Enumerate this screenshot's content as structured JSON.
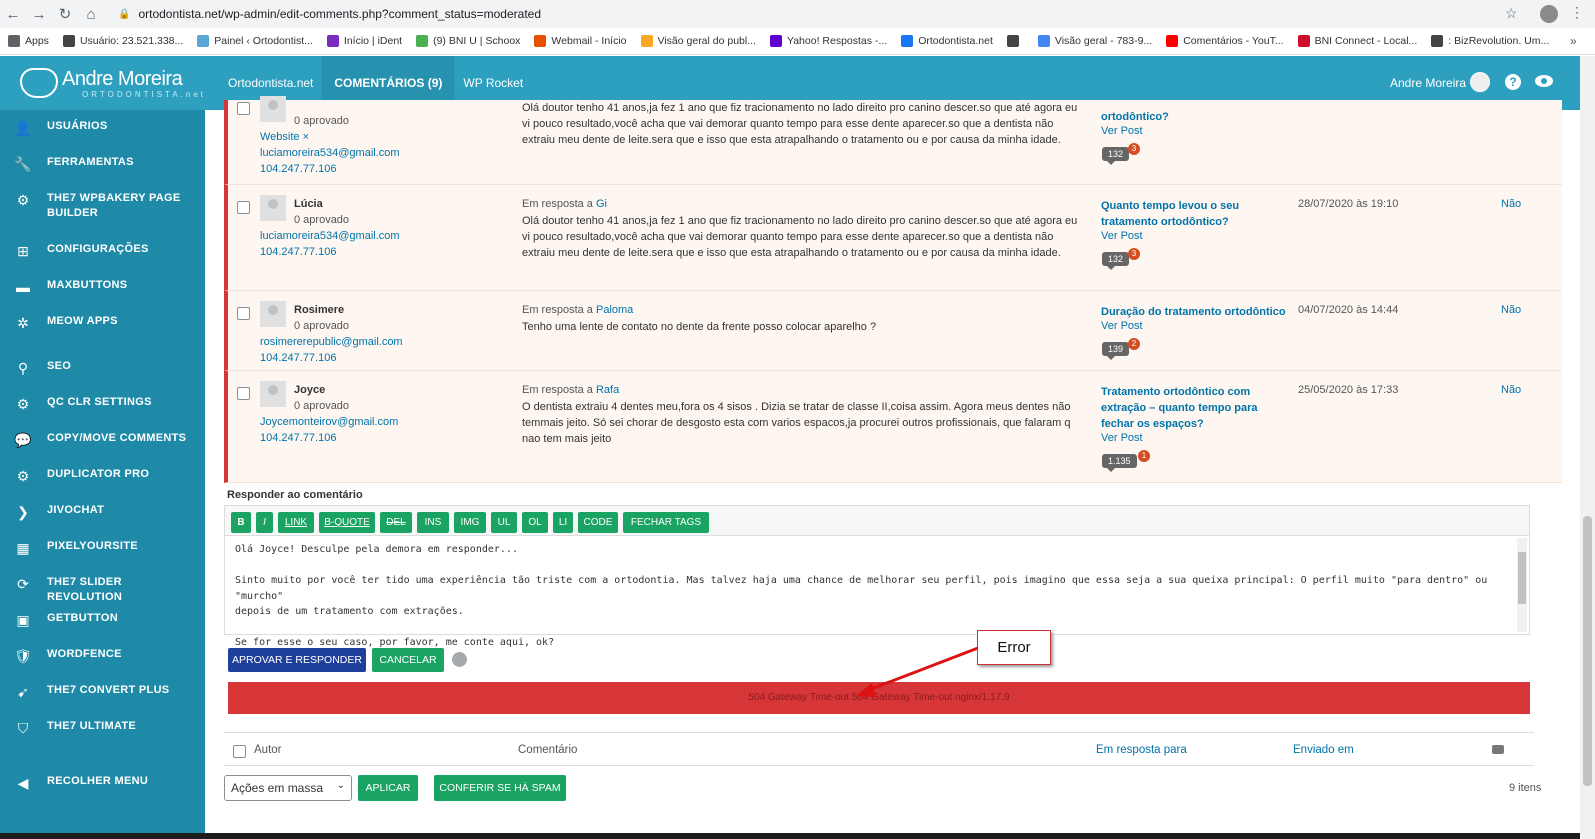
{
  "browser": {
    "url": "ortodontista.net/wp-admin/edit-comments.php?comment_status=moderated",
    "bookmarks": [
      {
        "label": "Apps",
        "color": "#5f6368"
      },
      {
        "label": "Usuário: 23.521.338...",
        "color": "#444"
      },
      {
        "label": "Painel ‹ Ortodontist...",
        "color": "#5aa7d6"
      },
      {
        "label": "Início | iDent",
        "color": "#7b2cbf"
      },
      {
        "label": "(9) BNI U | Schoox",
        "color": "#4caf50"
      },
      {
        "label": "Webmail - Início",
        "color": "#e65100"
      },
      {
        "label": "Visão geral do publ...",
        "color": "#f9a825"
      },
      {
        "label": "Yahoo! Respostas -...",
        "color": "#6001d2"
      },
      {
        "label": "Ortodontista.net",
        "color": "#1877f2"
      },
      {
        "label": "",
        "color": "#444"
      },
      {
        "label": "Visão geral - 783-9...",
        "color": "#4285f4"
      },
      {
        "label": "Comentários - YouT...",
        "color": "#ff0000"
      },
      {
        "label": "BNI Connect - Local...",
        "color": "#cf102d"
      },
      {
        "label": ": BizRevolution. Um...",
        "color": "#444"
      }
    ]
  },
  "admin_bar": {
    "logo_main": "Andre Moreira",
    "logo_sub": "ORTODONTISTA.net",
    "menu": [
      "Ortodontista.net",
      "COMENTÁRIOS (9)",
      "WP Rocket"
    ],
    "user": "Andre Moreira",
    "help": "?"
  },
  "sidebar": [
    {
      "label": "USUÁRIOS",
      "icon": "👤"
    },
    {
      "label": "FERRAMENTAS",
      "icon": "🔧"
    },
    {
      "label": "THE7 WPBAKERY PAGE BUILDER",
      "icon": "⚙"
    },
    {
      "label": "CONFIGURAÇÕES",
      "icon": "⊞"
    },
    {
      "label": "MAXBUTTONS",
      "icon": "▬"
    },
    {
      "label": "MEOW APPS",
      "icon": "✲"
    },
    {
      "label": "SEO",
      "icon": "⚲"
    },
    {
      "label": "QC CLR SETTINGS",
      "icon": "⚙"
    },
    {
      "label": "COPY/MOVE COMMENTS",
      "icon": "💬"
    },
    {
      "label": "DUPLICATOR PRO",
      "icon": "⚙"
    },
    {
      "label": "JIVOCHAT",
      "icon": "❯"
    },
    {
      "label": "PIXELYOURSITE",
      "icon": "▦"
    },
    {
      "label": "THE7 SLIDER REVOLUTION",
      "icon": "⟳"
    },
    {
      "label": "GETBUTTON",
      "icon": "▣"
    },
    {
      "label": "WORDFENCE",
      "icon": "🛡"
    },
    {
      "label": "THE7 CONVERT PLUS",
      "icon": "➹"
    },
    {
      "label": "THE7 ULTIMATE",
      "icon": "⛉"
    },
    {
      "label": "RECOLHER MENU",
      "icon": "◀"
    }
  ],
  "comments": [
    {
      "author": "",
      "status": "0 aprovado",
      "website": "Website ×",
      "email": "luciamoreira534@gmail.com",
      "ip": "104.247.77.106",
      "in_reply_prefix": "",
      "in_reply_name": "",
      "text": "Olá doutor tenho 41 anos,ja fez 1 ano que fiz tracionamento no lado direito pro canino descer.so que até agora eu vi pouco resultado,você acha que vai demorar quanto tempo para esse dente aparecer.so que a dentista não extraiu meu dente de leite.sera que e isso que esta atrapalhando o tratamento ou e por causa da minha idade.",
      "post": "ortodôntico?",
      "ver_post": "Ver Post",
      "count": "132",
      "pending": "3",
      "date": "",
      "nao": ""
    },
    {
      "author": "Lúcia",
      "status": "0 aprovado",
      "website": "",
      "email": "luciamoreira534@gmail.com",
      "ip": "104.247.77.106",
      "in_reply_prefix": "Em resposta a ",
      "in_reply_name": "Gi",
      "text": "Olá doutor tenho 41 anos,ja fez 1 ano que fiz tracionamento no lado direito pro canino descer.so que até agora eu vi pouco resultado,você acha que vai demorar quanto tempo para esse dente aparecer.so que a dentista não extraiu meu dente de leite.sera que e isso que esta atrapalhando o tratamento ou e por causa da minha idade.",
      "post": "Quanto tempo levou o seu tratamento ortodôntico?",
      "ver_post": "Ver Post",
      "count": "132",
      "pending": "3",
      "date": "28/07/2020 às 19:10",
      "nao": "Não"
    },
    {
      "author": "Rosimere",
      "status": "0 aprovado",
      "website": "",
      "email": "rosimererepublic@gmail.com",
      "ip": "104.247.77.106",
      "in_reply_prefix": "Em resposta a ",
      "in_reply_name": "Paloma",
      "text": "Tenho uma lente de contato no dente da frente posso colocar aparelho ?",
      "post": "Duração do tratamento ortodôntico",
      "ver_post": "Ver Post",
      "count": "139",
      "pending": "2",
      "date": "04/07/2020 às 14:44",
      "nao": "Não"
    },
    {
      "author": "Joyce",
      "status": "0 aprovado",
      "website": "",
      "email": "Joycemonteirov@gmail.com",
      "ip": "104.247.77.106",
      "in_reply_prefix": "Em resposta a ",
      "in_reply_name": "Rafa",
      "text": "O dentista extraiu 4 dentes meu,fora os 4 sisos . Dizia se tratar de classe II,coisa assim. Agora meus dentes não temmais jeito. Só sei chorar de desgosto esta com varios espacos,ja procurei outros profissionais, que falaram q nao tem mais jeito",
      "post": "Tratamento ortodôntico com extração – quanto tempo para fechar os espaços?",
      "ver_post": "Ver Post",
      "count": "1.135",
      "pending": "1",
      "date": "25/05/2020 às 17:33",
      "nao": "Não"
    }
  ],
  "reply": {
    "title": "Responder ao comentário",
    "tags": [
      "B",
      "I",
      "LINK",
      "B-QUOTE",
      "DEL",
      "INS",
      "IMG",
      "UL",
      "OL",
      "LI",
      "CODE",
      "FECHAR TAGS"
    ],
    "lines": [
      "Olá Joyce! Desculpe pela demora em responder...",
      "",
      "Sinto muito por você ter tido uma experiência tão triste com a ortodontia. Mas talvez haja uma chance de melhorar seu perfil, pois imagino que essa seja a sua queixa principal: O perfil muito \"para dentro\" ou \"murcho\"",
      "depois de um tratamento com extrações.",
      "",
      "Se for esse o seu caso, por favor, me conte aqui, ok?"
    ],
    "approve": "APROVAR E RESPONDER",
    "cancel": "CANCELAR",
    "error": "504 Gateway Time-out 504 Gateway Time-out nginx/1.17.9"
  },
  "annotation": {
    "label": "Error",
    "color": "#dd1111"
  },
  "table_header": {
    "autor": "Autor",
    "comentario": "Comentário",
    "em_resposta": "Em resposta para",
    "enviado": "Enviado em"
  },
  "footer": {
    "bulk": "Ações em massa",
    "apply": "APLICAR",
    "spam": "CONFERIR SE HÁ SPAM",
    "items": "9 itens"
  },
  "colors": {
    "accent": "#2da0c0",
    "sidebar": "#1e8aa8",
    "green": "#1ba363",
    "error": "#d63638"
  }
}
